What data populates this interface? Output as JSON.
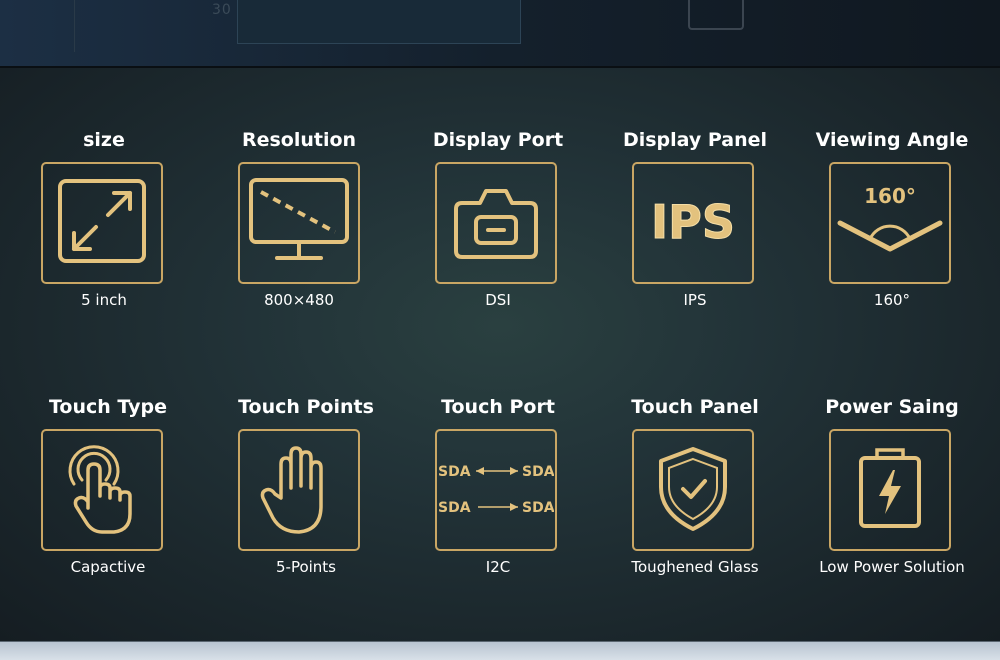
{
  "colors": {
    "gold": "#c9a664",
    "gold_light": "#f0d79a",
    "text": "#ffffff",
    "background": "#1f2f33"
  },
  "row1": [
    {
      "title": "size",
      "value": "5 inch",
      "icon": "expand-arrows-icon"
    },
    {
      "title": "Resolution",
      "value": "800×480",
      "icon": "monitor-diagonal-icon"
    },
    {
      "title": "Display Port",
      "value": "DSI",
      "icon": "camera-port-icon"
    },
    {
      "title": "Display Panel",
      "value": "IPS",
      "icon": "ips-text-icon",
      "icon_text": "IPS"
    },
    {
      "title": "Viewing Angle",
      "value": "160°",
      "icon": "viewing-angle-icon",
      "icon_text": "160°"
    }
  ],
  "row2": [
    {
      "title": "Touch Type",
      "value": "Capactive",
      "icon": "finger-touch-icon"
    },
    {
      "title": "Touch Points",
      "value": "5-Points",
      "icon": "hand-icon"
    },
    {
      "title": "Touch Port",
      "value": "I2C",
      "icon": "sda-arrows-icon",
      "icon_text": "SDA"
    },
    {
      "title": "Touch Panel",
      "value": "Toughened Glass",
      "icon": "shield-check-icon"
    },
    {
      "title": "Power Saing",
      "value": "Low Power Solution",
      "icon": "battery-bolt-icon"
    }
  ],
  "top_band": {
    "ghost_number": "30"
  }
}
